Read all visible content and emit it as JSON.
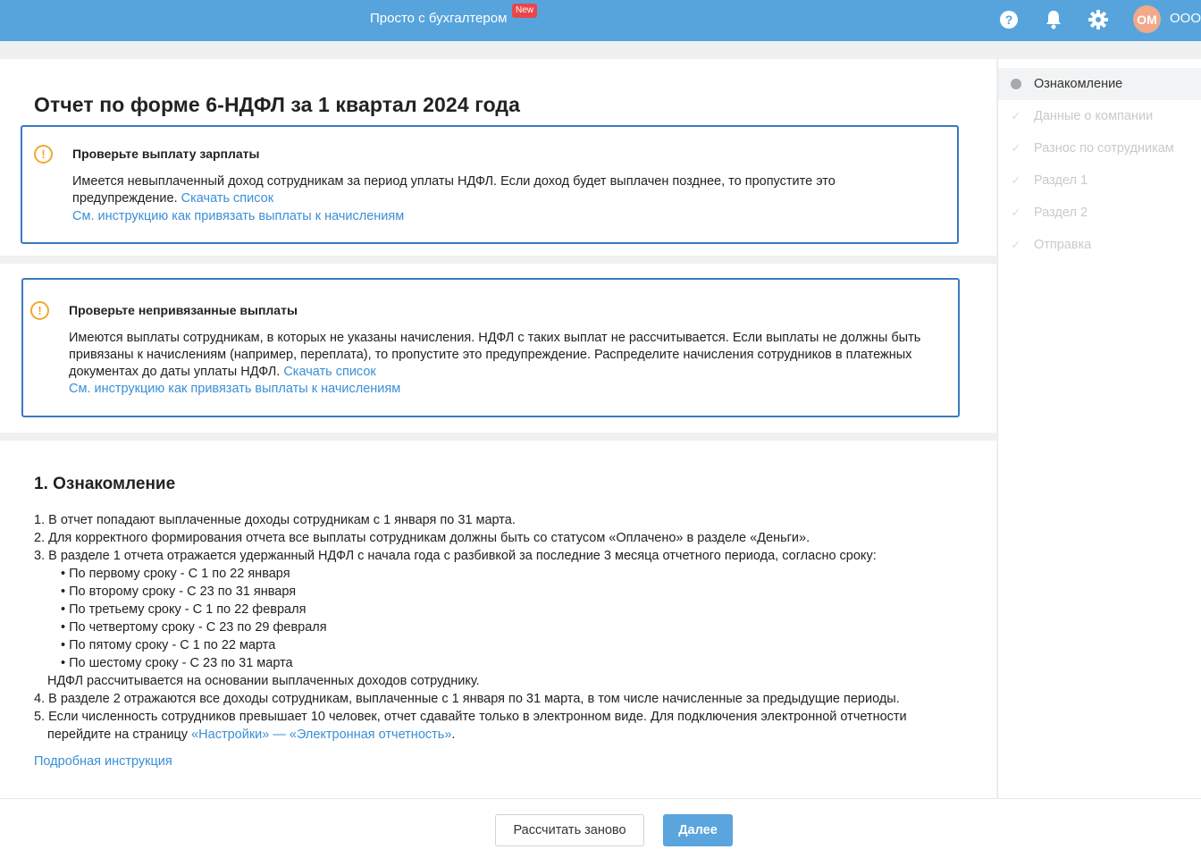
{
  "topbar": {
    "title": "Просто с бухгалтером",
    "new_badge": "New",
    "avatar_initials": "ОМ",
    "org_name": "ООО",
    "icons": [
      "help-icon",
      "bell-icon",
      "gear-icon"
    ]
  },
  "page": {
    "title": "Отчет по форме 6-НДФЛ за 1 квартал 2024 года"
  },
  "alerts": [
    {
      "title": "Проверьте выплату зарплаты",
      "text": "Имеется невыплаченный доход сотрудникам за период уплаты НДФЛ. Если доход будет выплачен позднее, то пропустите это предупреждение.",
      "download_link": "Скачать список",
      "instruction_link": "См. инструкцию как привязать выплаты к начислениям"
    },
    {
      "title": "Проверьте непривязанные выплаты",
      "text": "Имеются выплаты сотрудникам, в которых не указаны начисления. НДФЛ с таких выплат не рассчитывается. Если выплаты не должны быть привязаны к начислениям (например, переплата), то пропустите это предупреждение. Распределите начисления сотрудников в платежных документах до даты уплаты НДФЛ.",
      "download_link": "Скачать список",
      "instruction_link": "См. инструкцию как привязать выплаты к начислениям"
    }
  ],
  "intro": {
    "title": "1. Ознакомление",
    "item1": "1. В отчет попадают выплаченные доходы сотрудникам с 1 января по 31 марта.",
    "item2": "2. Для корректного формирования отчета все выплаты сотрудникам должны быть со статусом «Оплачено» в разделе «Деньги».",
    "item3": "3. В разделе 1 отчета отражается удержанный НДФЛ с начала года с разбивкой за последние 3 месяца отчетного периода, согласно сроку:",
    "terms": [
      "• По первому сроку - С 1 по 22 января",
      "• По второму сроку - С 23 по 31 января",
      "• По третьему сроку - С 1 по 22 февраля",
      "• По четвертому сроку - С 23 по 29 февраля",
      "• По пятому сроку - С 1 по 22 марта",
      "• По шестому сроку - С 23 по 31 марта"
    ],
    "item3_note": "НДФЛ рассчитывается на основании выплаченных доходов сотруднику.",
    "item4": "4. В разделе 2 отражаются все доходы сотрудникам, выплаченные с 1 января по 31 марта, в том числе начисленные за предыдущие периоды.",
    "item5_text": "5. Если численность сотрудников превышает 10 человек, отчет сдавайте только в электронном виде. Для подключения электронной отчетности",
    "item5_cont": "перейдите на страницу ",
    "item5_link": "«Настройки» — «Электронная отчетность»",
    "item5_end": ".",
    "detail_link": "Подробная инструкция"
  },
  "sidebar": {
    "steps": [
      {
        "label": "Ознакомление",
        "state": "active"
      },
      {
        "label": "Данные о компании",
        "state": "inactive"
      },
      {
        "label": "Разнос по сотрудникам",
        "state": "inactive"
      },
      {
        "label": "Раздел 1",
        "state": "inactive"
      },
      {
        "label": "Раздел 2",
        "state": "inactive"
      },
      {
        "label": "Отправка",
        "state": "inactive"
      }
    ]
  },
  "footer": {
    "recalc_label": "Рассчитать заново",
    "next_label": "Далее"
  },
  "colors": {
    "topbar": "#57a4dc",
    "alert_border": "#3b7ac0",
    "warning": "#f0a92d",
    "link": "#3a8fd6",
    "badge": "#e8474a",
    "avatar": "#f1a98a",
    "primary_button": "#5aa5de"
  }
}
